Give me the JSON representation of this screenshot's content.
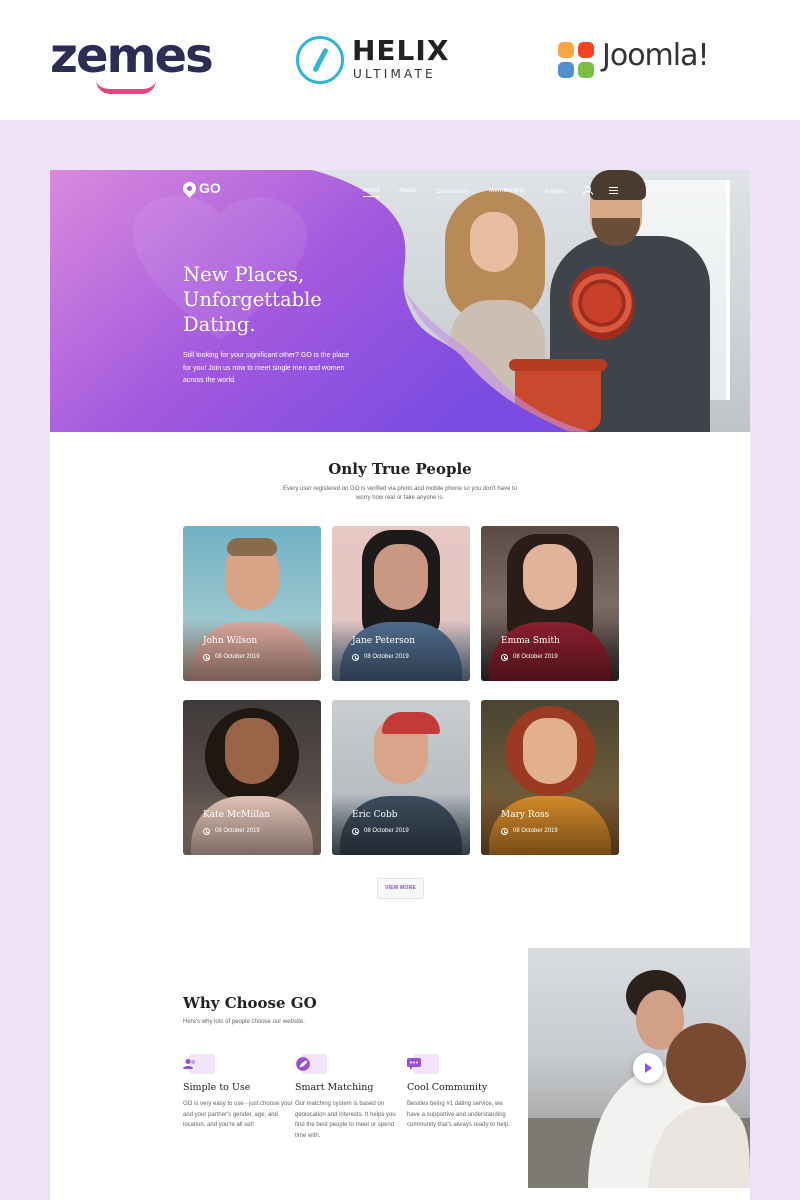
{
  "brands": {
    "zemes": "zemes",
    "helix_name": "HELIX",
    "helix_sub": "ULTIMATE",
    "joomla": "Joomla!"
  },
  "site": {
    "logo_text": "GO",
    "nav": {
      "home": "Home",
      "about": "About",
      "community": "Community",
      "membership": "Membership",
      "pages": "Pages"
    },
    "hero": {
      "title_line1": "New Places,",
      "title_line2": "Unforgettable",
      "title_line3": "Dating.",
      "text": "Still looking for your significant other? GO is the place for you! Join us now to meet single men and women across the world."
    },
    "people": {
      "title": "Only True People",
      "subtitle": "Every user registered on GO is verified via photo and mobile phone so you don't have to worry how real or fake anyone is.",
      "cards": [
        {
          "name": "John Wilson",
          "date": "08 October 2019"
        },
        {
          "name": "Jane Peterson",
          "date": "08 October 2019"
        },
        {
          "name": "Emma Smith",
          "date": "08 October 2019"
        },
        {
          "name": "Kate McMillan",
          "date": "08 October 2019"
        },
        {
          "name": "Eric Cobb",
          "date": "08 October 2019"
        },
        {
          "name": "Mary Ross",
          "date": "08 October 2019"
        }
      ],
      "view_more": "VIEW MORE"
    },
    "why": {
      "title": "Why Choose GO",
      "subtitle": "Here's why lots of people choose our website.",
      "features": [
        {
          "title": "Simple to Use",
          "text": "GO is very easy to use - just choose your and your partner's gender, age, and location, and you're all set!",
          "icon": "users-icon"
        },
        {
          "title": "Smart Matching",
          "text": "Our matching system is based on geolocation and interests. It helps you find the best people to meet or spend time with.",
          "icon": "leaf-icon"
        },
        {
          "title": "Cool Community",
          "text": "Besides being #1 dating service, we have a supportive and understanding community that's always ready to help.",
          "icon": "chat-icon"
        }
      ]
    }
  },
  "colors": {
    "accent": "#9b4fd4",
    "hero_gradient_start": "#d77fdc",
    "hero_gradient_end": "#7f4fe0",
    "lavender_bg": "#efe3f9"
  }
}
